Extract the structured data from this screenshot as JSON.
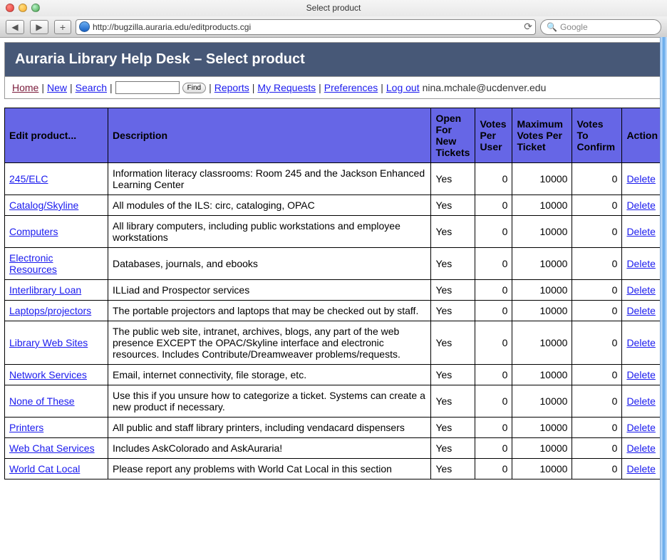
{
  "window": {
    "title": "Select product"
  },
  "toolbar": {
    "url": "http://bugzilla.auraria.edu/editproducts.cgi",
    "search_placeholder": "Google"
  },
  "header": {
    "title": "Auraria Library Help Desk – Select product"
  },
  "nav": {
    "home": "Home",
    "new": "New",
    "search": "Search",
    "find": "Find",
    "reports": "Reports",
    "my_requests": "My Requests",
    "preferences": "Preferences",
    "logout": "Log out",
    "user": "nina.mchale@ucdenver.edu"
  },
  "table": {
    "headers": {
      "edit": "Edit product...",
      "desc": "Description",
      "open": "Open For New Tickets",
      "votes_user": "Votes Per User",
      "max_votes": "Maximum Votes Per Ticket",
      "votes_confirm": "Votes To Confirm",
      "action": "Action"
    },
    "action_label": "Delete",
    "rows": [
      {
        "name": "245/ELC",
        "desc": "Information literacy classrooms: Room 245 and the Jackson Enhanced Learning Center",
        "open": "Yes",
        "vpu": "0",
        "max": "10000",
        "vtc": "0"
      },
      {
        "name": "Catalog/Skyline",
        "desc": "All modules of the ILS: circ, cataloging, OPAC",
        "open": "Yes",
        "vpu": "0",
        "max": "10000",
        "vtc": "0"
      },
      {
        "name": "Computers",
        "desc": "All library computers, including public workstations and employee workstations",
        "open": "Yes",
        "vpu": "0",
        "max": "10000",
        "vtc": "0"
      },
      {
        "name": "Electronic Resources",
        "desc": "Databases, journals, and ebooks",
        "open": "Yes",
        "vpu": "0",
        "max": "10000",
        "vtc": "0"
      },
      {
        "name": "Interlibrary Loan",
        "desc": "ILLiad and Prospector services",
        "open": "Yes",
        "vpu": "0",
        "max": "10000",
        "vtc": "0"
      },
      {
        "name": "Laptops/projectors",
        "desc": "The portable projectors and laptops that may be checked out by staff.",
        "open": "Yes",
        "vpu": "0",
        "max": "10000",
        "vtc": "0"
      },
      {
        "name": "Library Web Sites",
        "desc": "The public web site, intranet, archives, blogs, any part of the web presence EXCEPT the OPAC/Skyline interface and electronic resources. Includes Contribute/Dreamweaver problems/requests.",
        "open": "Yes",
        "vpu": "0",
        "max": "10000",
        "vtc": "0"
      },
      {
        "name": "Network Services",
        "desc": "Email, internet connectivity, file storage, etc.",
        "open": "Yes",
        "vpu": "0",
        "max": "10000",
        "vtc": "0"
      },
      {
        "name": "None of These",
        "desc": "Use this if you unsure how to categorize a ticket. Systems can create a new product if necessary.",
        "open": "Yes",
        "vpu": "0",
        "max": "10000",
        "vtc": "0"
      },
      {
        "name": "Printers",
        "desc": "All public and staff library printers, including vendacard dispensers",
        "open": "Yes",
        "vpu": "0",
        "max": "10000",
        "vtc": "0"
      },
      {
        "name": "Web Chat Services",
        "desc": "Includes AskColorado and AskAuraria!",
        "open": "Yes",
        "vpu": "0",
        "max": "10000",
        "vtc": "0"
      },
      {
        "name": "World Cat Local",
        "desc": "Please report any problems with World Cat Local in this section",
        "open": "Yes",
        "vpu": "0",
        "max": "10000",
        "vtc": "0"
      }
    ]
  }
}
